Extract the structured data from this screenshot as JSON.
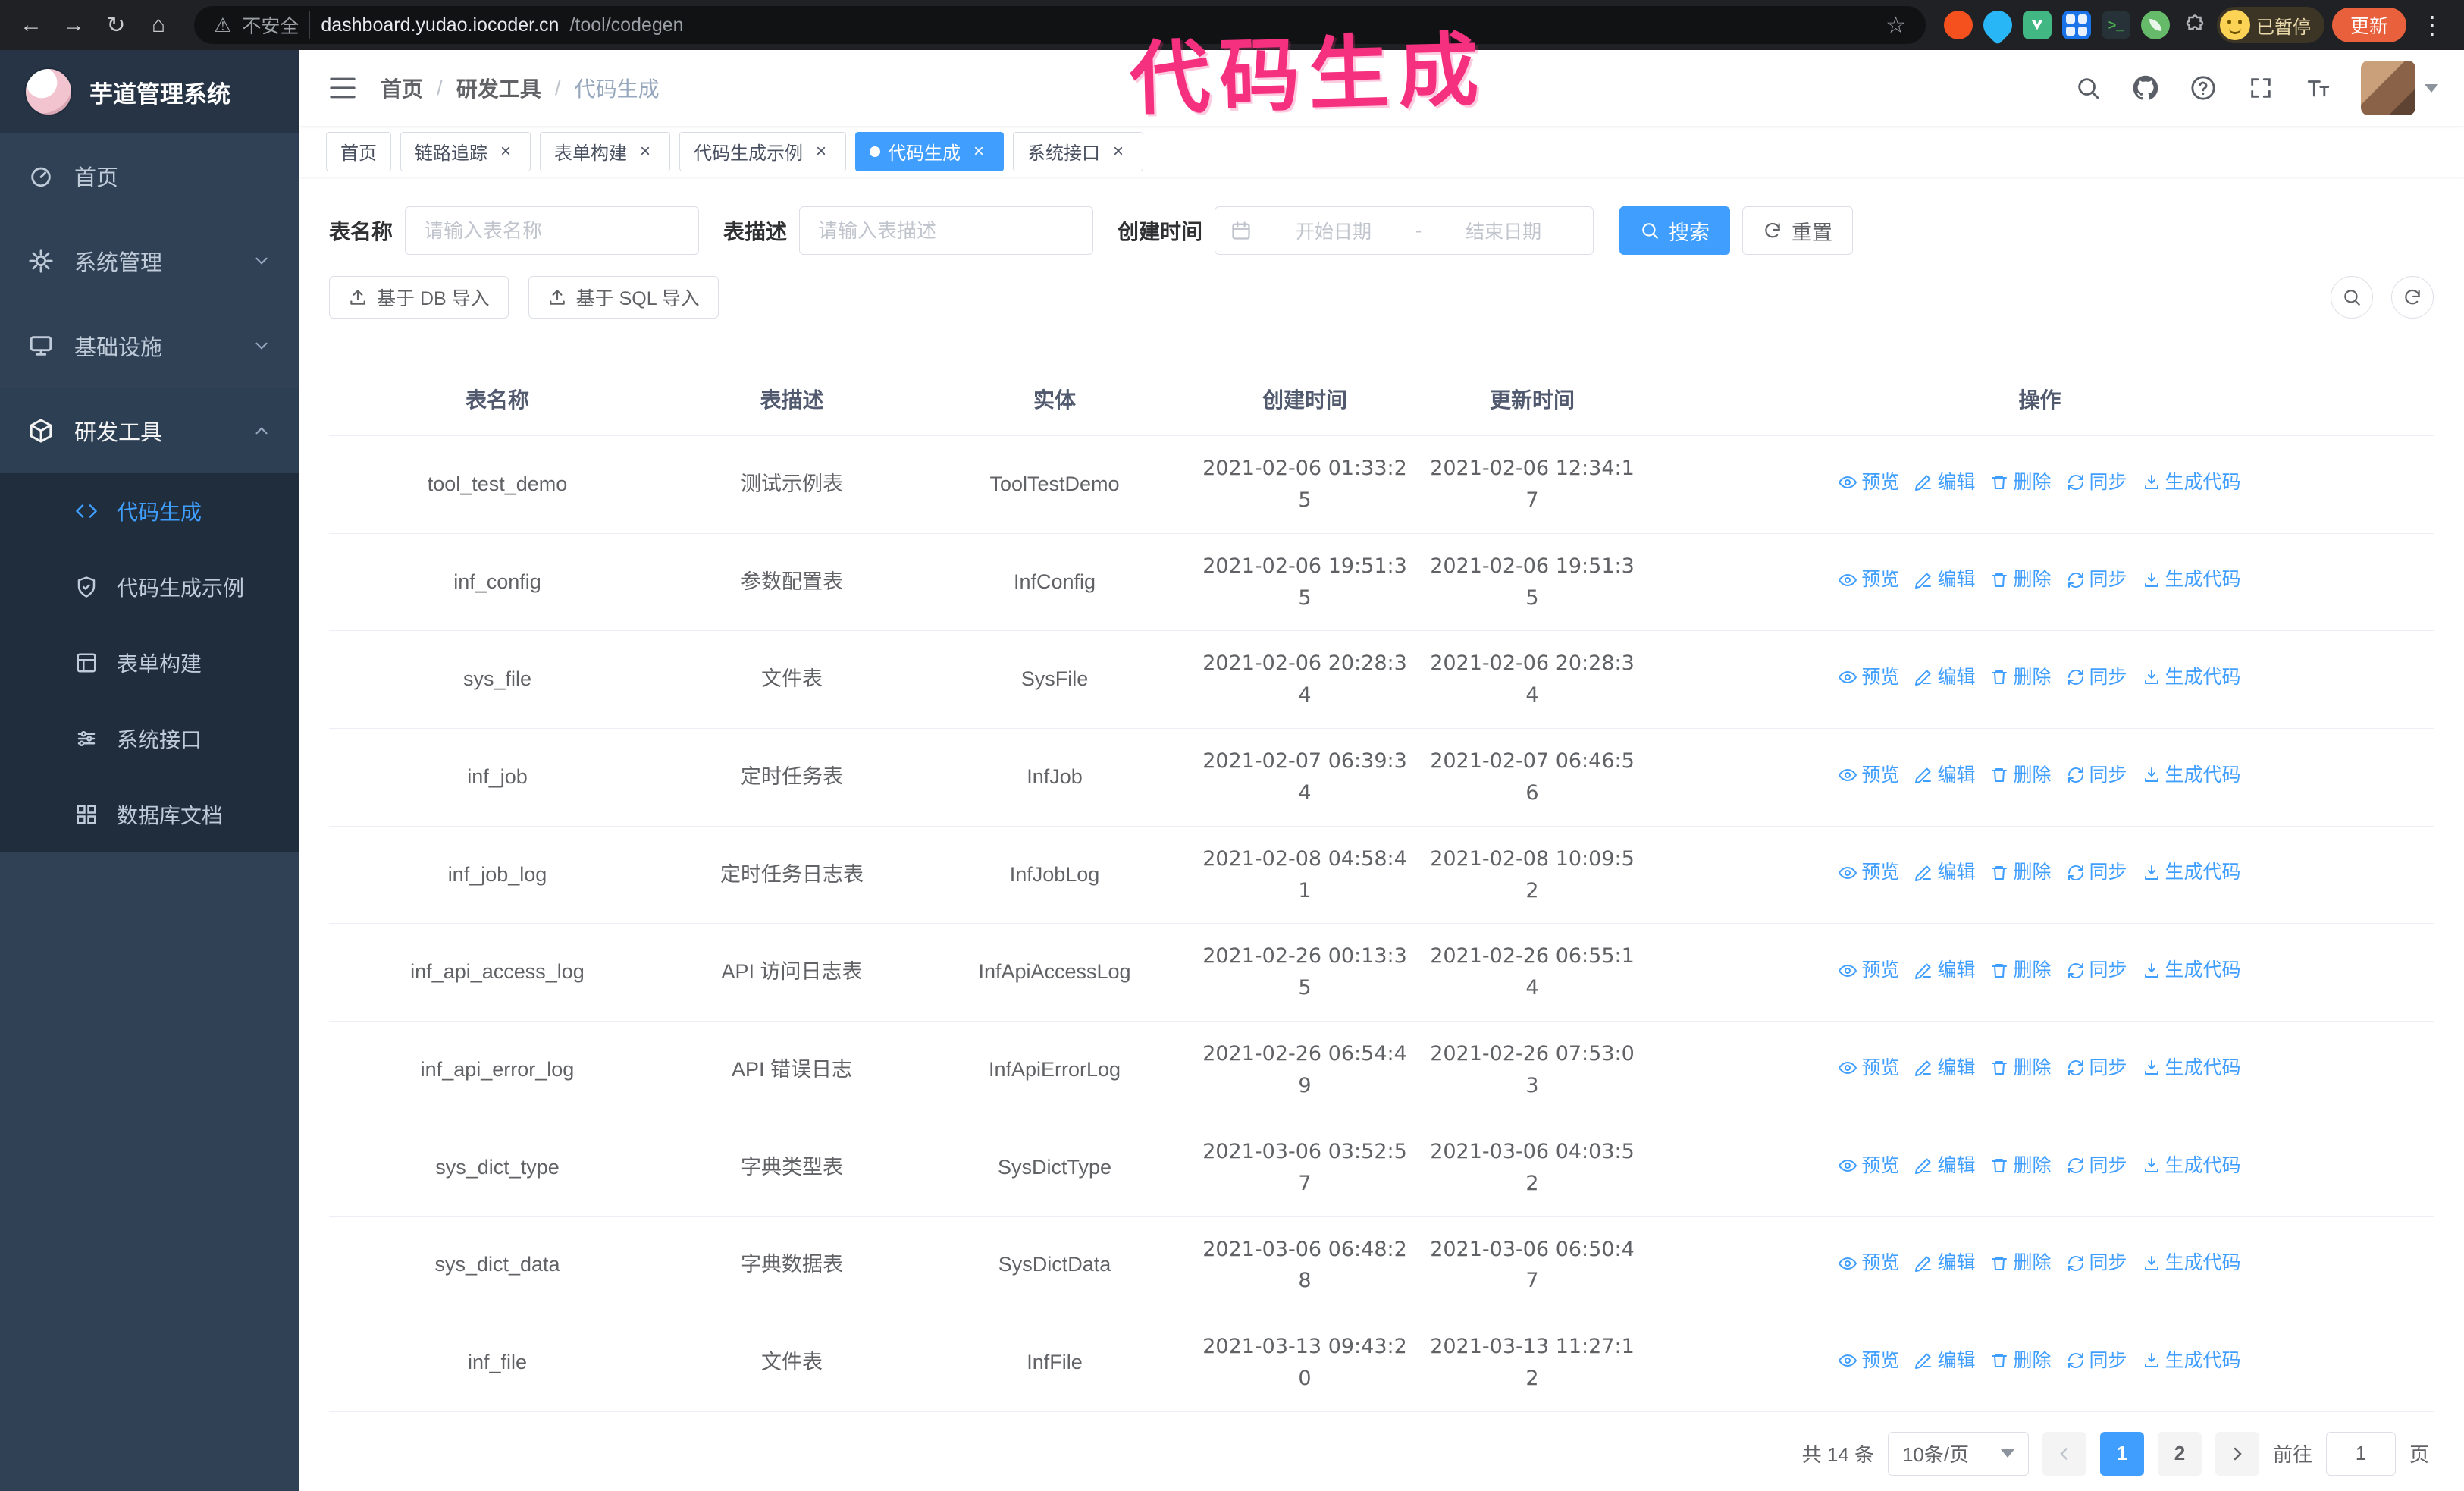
{
  "browser": {
    "security_label": "不安全",
    "url_host": "dashboard.yudao.iocoder.cn",
    "url_path": "/tool/codegen",
    "paused_badge": "已暂停",
    "update_button": "更新"
  },
  "annotation": {
    "text": "代码生成",
    "color": "#f5317f"
  },
  "sidebar": {
    "logo_title": "芋道管理系统",
    "items": [
      {
        "label": "首页"
      },
      {
        "label": "系统管理"
      },
      {
        "label": "基础设施"
      },
      {
        "label": "研发工具"
      }
    ],
    "dev_children": [
      {
        "label": "代码生成",
        "active": true
      },
      {
        "label": "代码生成示例"
      },
      {
        "label": "表单构建"
      },
      {
        "label": "系统接口"
      },
      {
        "label": "数据库文档"
      }
    ]
  },
  "navbar": {
    "breadcrumb": [
      "首页",
      "研发工具",
      "代码生成"
    ],
    "separator": "/"
  },
  "tags": [
    {
      "label": "首页"
    },
    {
      "label": "链路追踪"
    },
    {
      "label": "表单构建"
    },
    {
      "label": "代码生成示例"
    },
    {
      "label": "代码生成",
      "active": true
    },
    {
      "label": "系统接口"
    }
  ],
  "filters": {
    "table_name_label": "表名称",
    "table_name_placeholder": "请输入表名称",
    "table_desc_label": "表描述",
    "table_desc_placeholder": "请输入表描述",
    "create_time_label": "创建时间",
    "date_start_placeholder": "开始日期",
    "date_separator": "-",
    "date_end_placeholder": "结束日期",
    "search_button": "搜索",
    "reset_button": "重置"
  },
  "toolbar": {
    "import_db_button": "基于 DB 导入",
    "import_sql_button": "基于 SQL 导入"
  },
  "table": {
    "columns": [
      "表名称",
      "表描述",
      "实体",
      "创建时间",
      "更新时间",
      "操作"
    ],
    "row_actions": [
      "预览",
      "编辑",
      "删除",
      "同步",
      "生成代码"
    ],
    "rows": [
      {
        "name": "tool_test_demo",
        "desc": "测试示例表",
        "entity": "ToolTestDemo",
        "create_time": "2021-02-06 01:33:25",
        "update_time": "2021-02-06 12:34:17"
      },
      {
        "name": "inf_config",
        "desc": "参数配置表",
        "entity": "InfConfig",
        "create_time": "2021-02-06 19:51:35",
        "update_time": "2021-02-06 19:51:35"
      },
      {
        "name": "sys_file",
        "desc": "文件表",
        "entity": "SysFile",
        "create_time": "2021-02-06 20:28:34",
        "update_time": "2021-02-06 20:28:34"
      },
      {
        "name": "inf_job",
        "desc": "定时任务表",
        "entity": "InfJob",
        "create_time": "2021-02-07 06:39:34",
        "update_time": "2021-02-07 06:46:56"
      },
      {
        "name": "inf_job_log",
        "desc": "定时任务日志表",
        "entity": "InfJobLog",
        "create_time": "2021-02-08 04:58:41",
        "update_time": "2021-02-08 10:09:52"
      },
      {
        "name": "inf_api_access_log",
        "desc": "API 访问日志表",
        "entity": "InfApiAccessLog",
        "create_time": "2021-02-26 00:13:35",
        "update_time": "2021-02-26 06:55:14"
      },
      {
        "name": "inf_api_error_log",
        "desc": "API 错误日志",
        "entity": "InfApiErrorLog",
        "create_time": "2021-02-26 06:54:49",
        "update_time": "2021-02-26 07:53:03"
      },
      {
        "name": "sys_dict_type",
        "desc": "字典类型表",
        "entity": "SysDictType",
        "create_time": "2021-03-06 03:52:57",
        "update_time": "2021-03-06 04:03:52"
      },
      {
        "name": "sys_dict_data",
        "desc": "字典数据表",
        "entity": "SysDictData",
        "create_time": "2021-03-06 06:48:28",
        "update_time": "2021-03-06 06:50:47"
      },
      {
        "name": "inf_file",
        "desc": "文件表",
        "entity": "InfFile",
        "create_time": "2021-03-13 09:43:20",
        "update_time": "2021-03-13 11:27:12"
      }
    ]
  },
  "pagination": {
    "total_text": "共 14 条",
    "page_size": "10条/页",
    "pages": [
      "1",
      "2"
    ],
    "goto_prefix": "前往",
    "goto_value": "1",
    "goto_suffix": "页"
  }
}
